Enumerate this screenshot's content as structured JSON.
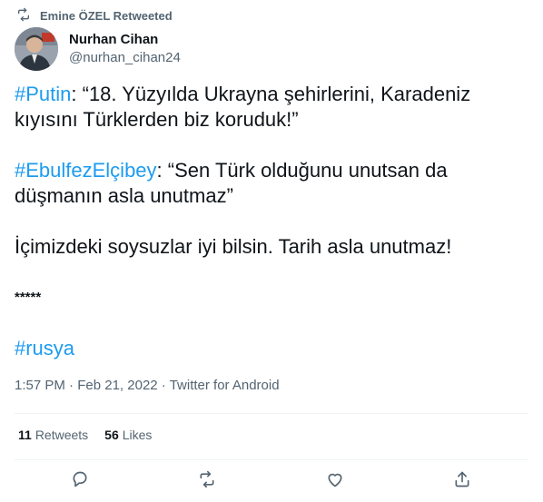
{
  "retweet_context": {
    "label": "Emine ÖZEL Retweeted",
    "icon": "retweet-icon"
  },
  "author": {
    "display_name": "Nurhan Cihan",
    "handle": "@nurhan_cihan24"
  },
  "tweet": {
    "p1": {
      "hashtag": "#Putin",
      "text": ": “18. Yüzyılda Ukrayna şehirlerini, Karadeniz kıyısını Türklerden biz koruduk!”"
    },
    "p2": {
      "hashtag": "#EbulfezElçibey",
      "text": ": “Sen Türk olduğunu unutsan da düşmanın asla unutmaz”"
    },
    "p3": "İçimizdeki soysuzlar iyi bilsin. Tarih asla unutmaz!",
    "p4": "*****",
    "p5_hashtag": "#rusya"
  },
  "meta": {
    "time": "1:57 PM",
    "sep1": " · ",
    "date": "Feb 21, 2022",
    "sep2": " · ",
    "source": "Twitter for Android"
  },
  "stats": {
    "retweets_count": "11",
    "retweets_label": "Retweets",
    "likes_count": "56",
    "likes_label": "Likes"
  },
  "colors": {
    "accent": "#1d9bf0",
    "muted": "#536471",
    "text": "#0f1419",
    "divider": "#eff3f4"
  },
  "actions": [
    "reply-icon",
    "retweet-icon",
    "like-icon",
    "share-icon"
  ]
}
